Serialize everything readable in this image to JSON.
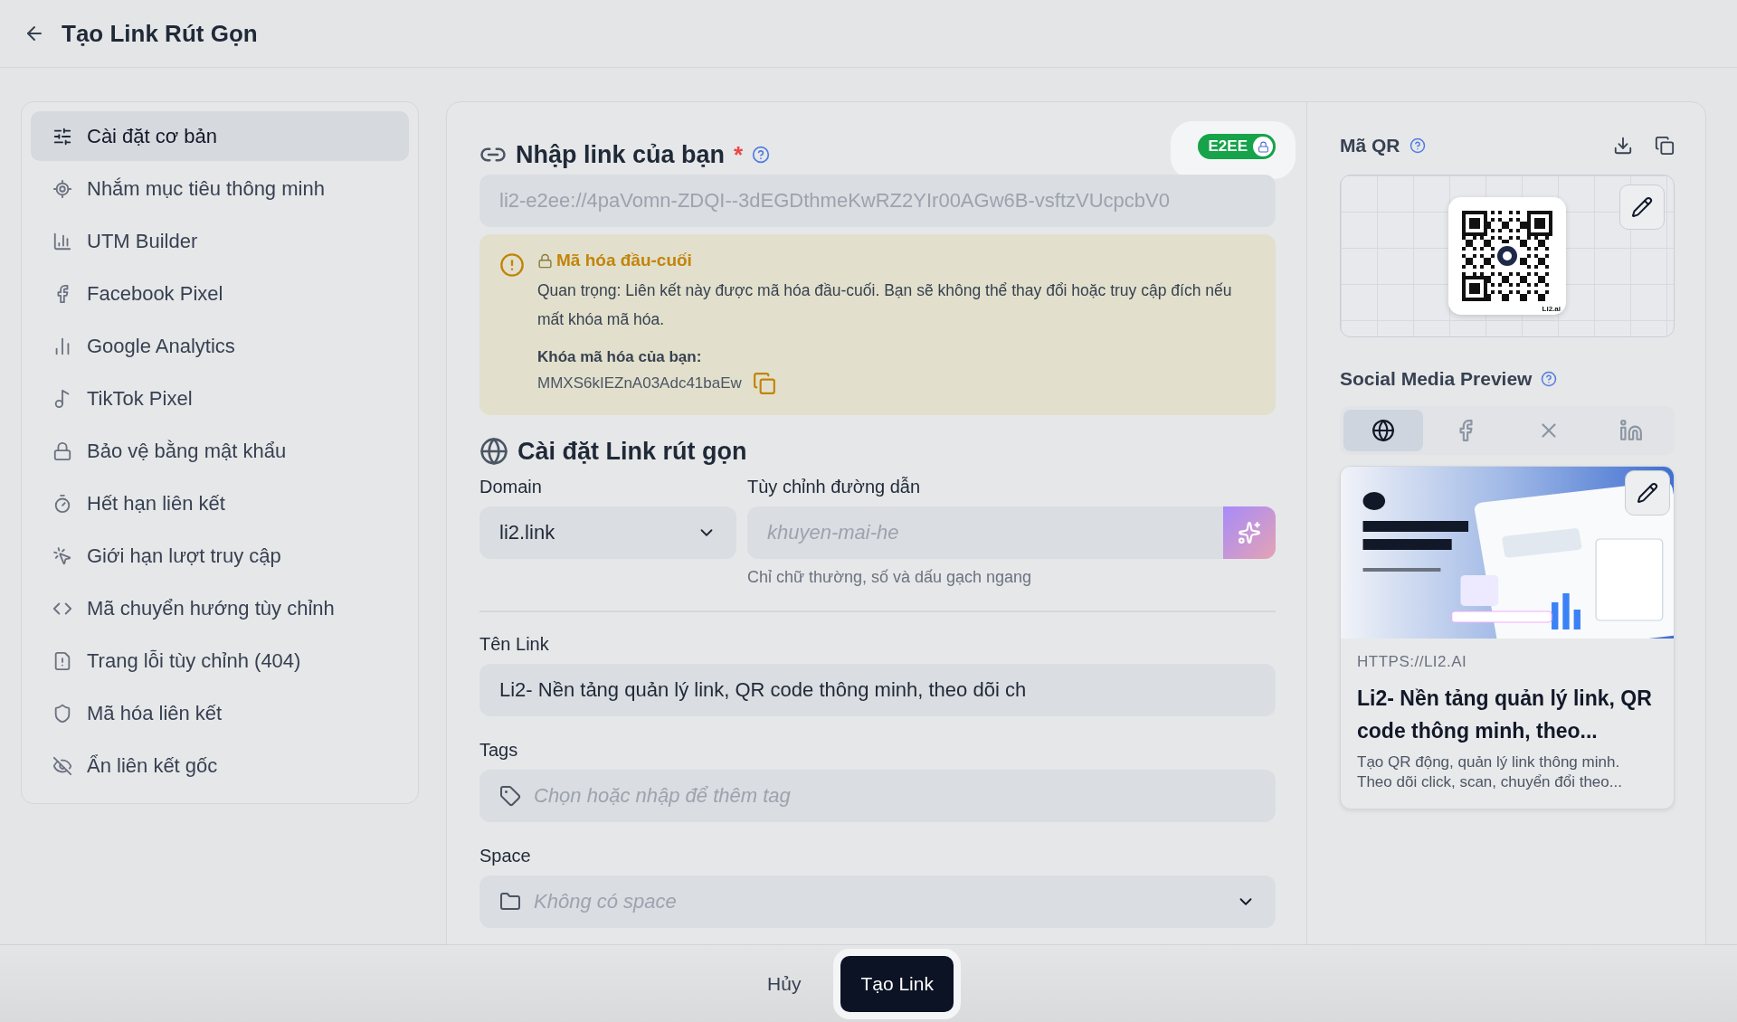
{
  "header": {
    "title": "Tạo Link Rút Gọn"
  },
  "sidebar": {
    "items": [
      {
        "label": "Cài đặt cơ bản",
        "selected": true
      },
      {
        "label": "Nhắm mục tiêu thông minh",
        "selected": false
      },
      {
        "label": "UTM Builder",
        "selected": false
      },
      {
        "label": "Facebook Pixel",
        "selected": false
      },
      {
        "label": "Google Analytics",
        "selected": false
      },
      {
        "label": "TikTok Pixel",
        "selected": false
      },
      {
        "label": "Bảo vệ bằng mật khẩu",
        "selected": false
      },
      {
        "label": "Hết hạn liên kết",
        "selected": false
      },
      {
        "label": "Giới hạn lượt truy cập",
        "selected": false
      },
      {
        "label": "Mã chuyển hướng tùy chỉnh",
        "selected": false
      },
      {
        "label": "Trang lỗi tùy chỉnh (404)",
        "selected": false
      },
      {
        "label": "Mã hóa liên kết",
        "selected": false
      },
      {
        "label": "Ẩn liên kết gốc",
        "selected": false
      }
    ]
  },
  "link_section": {
    "title": "Nhập link của bạn",
    "required_mark": "*",
    "e2ee": {
      "label": "E2EE",
      "on": true
    },
    "url_value": "li2-e2ee://4paVomn-ZDQI--3dEGDthmeKwRZ2YIr00AGw6B-vsftzVUcpcbV0"
  },
  "warning": {
    "title": "Mã hóa đầu-cuối",
    "message": "Quan trọng: Liên kết này được mã hóa đầu-cuối. Bạn sẽ không thể thay đổi hoặc truy cập đích nếu mất khóa mã hóa.",
    "key_label": "Khóa mã hóa của bạn:",
    "key_value": "MMXS6kIEZnA03Adc41baEw"
  },
  "settings": {
    "title": "Cài đặt Link rút gọn",
    "domain_label": "Domain",
    "domain_value": "li2.link",
    "path_label": "Tùy chỉnh đường dẫn",
    "path_placeholder": "khuyen-mai-he",
    "path_hint": "Chỉ chữ thường, số và dấu gạch ngang"
  },
  "name_field": {
    "label": "Tên Link",
    "value": "Li2- Nền tảng quản lý link, QR code thông minh, theo dõi ch"
  },
  "tags_field": {
    "label": "Tags",
    "placeholder": "Chọn hoặc nhập để thêm tag"
  },
  "space_field": {
    "label": "Space",
    "placeholder": "Không có space"
  },
  "qr": {
    "title": "Mã QR",
    "caption": "Li2.ai"
  },
  "preview": {
    "title": "Social Media Preview",
    "tabs": [
      {
        "selected": true
      },
      {
        "selected": false
      },
      {
        "selected": false
      },
      {
        "selected": false
      }
    ],
    "url": "HTTPS://LI2.AI",
    "headline": "Li2- Nền tảng quản lý link, QR code thông minh, theo...",
    "description": "Tạo QR động, quản lý link thông minh. Theo dõi click, scan, chuyển đổi theo..."
  },
  "footer": {
    "buttons": [
      {
        "label": "Hủy",
        "kind": "secondary"
      },
      {
        "label": "Tạo Link",
        "kind": "primary"
      }
    ]
  }
}
